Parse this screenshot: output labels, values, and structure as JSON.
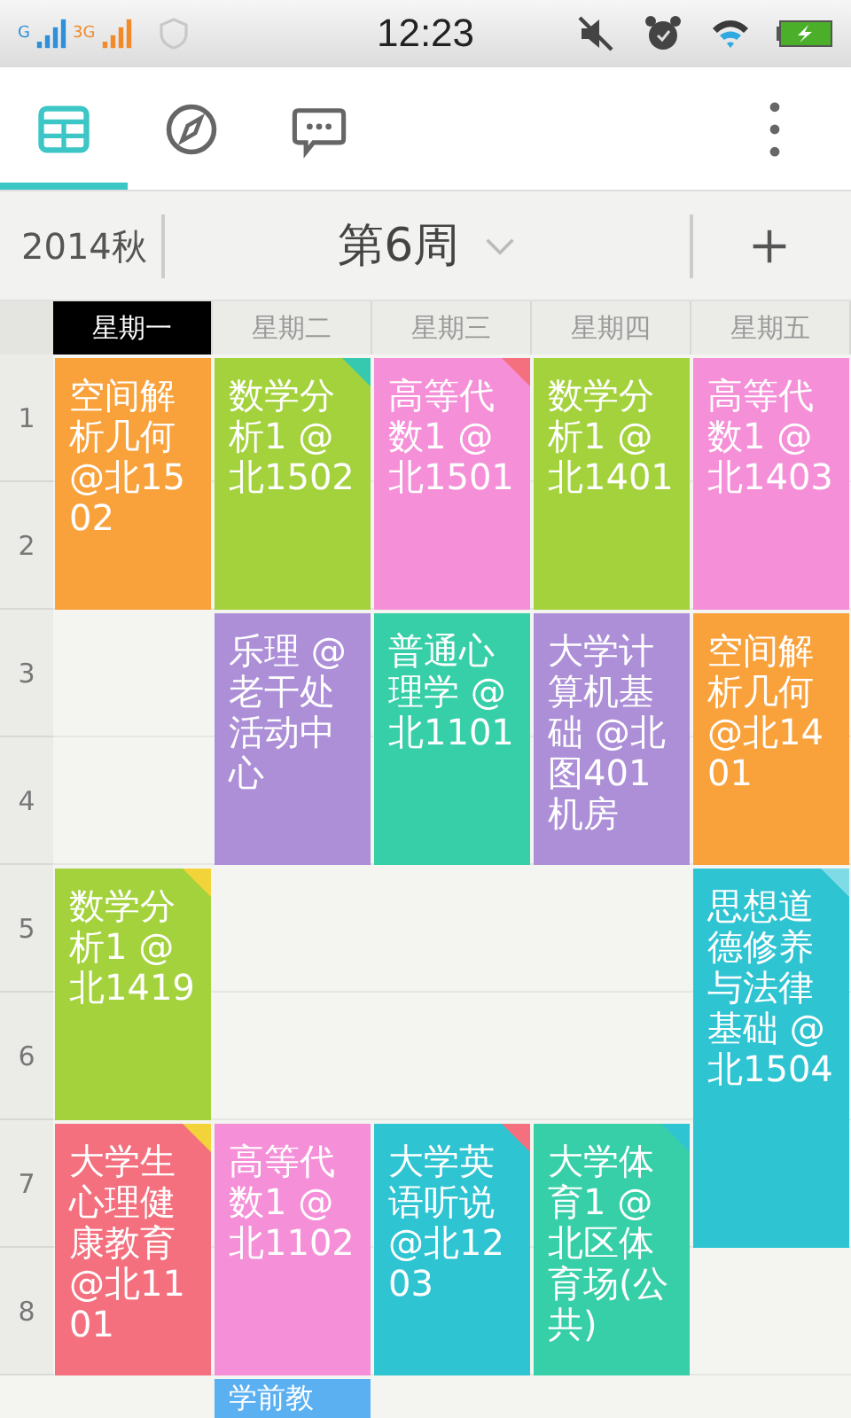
{
  "status_bar": {
    "carrier_1": "G",
    "carrier_2": "3G",
    "time": "12:23"
  },
  "tabs": [
    {
      "kind": "calendar",
      "selected": true
    },
    {
      "kind": "compass",
      "selected": false
    },
    {
      "kind": "chat",
      "selected": false
    }
  ],
  "week_bar": {
    "term": "2014秋",
    "week": "第6周"
  },
  "days": [
    {
      "label": "星期一",
      "selected": true
    },
    {
      "label": "星期二",
      "selected": false
    },
    {
      "label": "星期三",
      "selected": false
    },
    {
      "label": "星期四",
      "selected": false
    },
    {
      "label": "星期五",
      "selected": false
    }
  ],
  "periods": [
    "1",
    "2",
    "3",
    "4",
    "5",
    "6",
    "7",
    "8"
  ],
  "columns": [
    {
      "slots": [
        {
          "kind": "double",
          "text": "空间解析几何@北1502",
          "color": "#f9a23c"
        },
        {
          "kind": "empty"
        },
        {
          "kind": "empty"
        },
        {
          "kind": "double",
          "text": "数学分析1 @北1419",
          "color": "#a3d23c",
          "corner": {
            "color": "#f2d43a"
          }
        },
        {
          "kind": "double",
          "text": "大学生心理健康教育@北1101",
          "color": "#f4707e",
          "corner": {
            "color": "#f2d43a"
          }
        }
      ]
    },
    {
      "slots": [
        {
          "kind": "double",
          "text": "数学分析1 @北1502",
          "color": "#a3d23c",
          "corner": {
            "color": "#36c9b0"
          }
        },
        {
          "kind": "double",
          "text": "乐理 @老干处活动中心",
          "color": "#ad8fd8"
        },
        {
          "kind": "empty"
        },
        {
          "kind": "empty"
        },
        {
          "kind": "double",
          "text": "高等代数1 @北1102",
          "color": "#f590d8"
        },
        {
          "kind": "single",
          "text": "学前教",
          "color": "#5bb0f2"
        }
      ]
    },
    {
      "slots": [
        {
          "kind": "double",
          "text": "高等代数1 @北1501",
          "color": "#f590d8",
          "corner": {
            "color": "#f4707e"
          }
        },
        {
          "kind": "double",
          "text": "普通心理学 @北1101",
          "color": "#36cfa8"
        },
        {
          "kind": "empty"
        },
        {
          "kind": "empty"
        },
        {
          "kind": "double",
          "text": "大学英语听说@北1203",
          "color": "#2fc4d2",
          "corner": {
            "color": "#f4707e"
          }
        }
      ]
    },
    {
      "slots": [
        {
          "kind": "double",
          "text": "数学分析1 @北1401",
          "color": "#a3d23c"
        },
        {
          "kind": "double",
          "text": "大学计算机基础 @北图401机房",
          "color": "#ad8fd8"
        },
        {
          "kind": "empty"
        },
        {
          "kind": "empty"
        },
        {
          "kind": "double",
          "text": "大学体育1 @北区体育场(公共)",
          "color": "#36cfa8",
          "corner": {
            "color": "#2fc4d2"
          }
        }
      ]
    },
    {
      "slots": [
        {
          "kind": "double",
          "text": "高等代数1 @北1403",
          "color": "#f590d8"
        },
        {
          "kind": "double",
          "text": "空间解析几何@北1401",
          "color": "#f9a23c"
        },
        {
          "kind": "triple",
          "text": "思想道德修养与法律基础 @北1504",
          "color": "#2fc4d2",
          "corner": {
            "color": "#7fdce6"
          }
        }
      ]
    }
  ]
}
